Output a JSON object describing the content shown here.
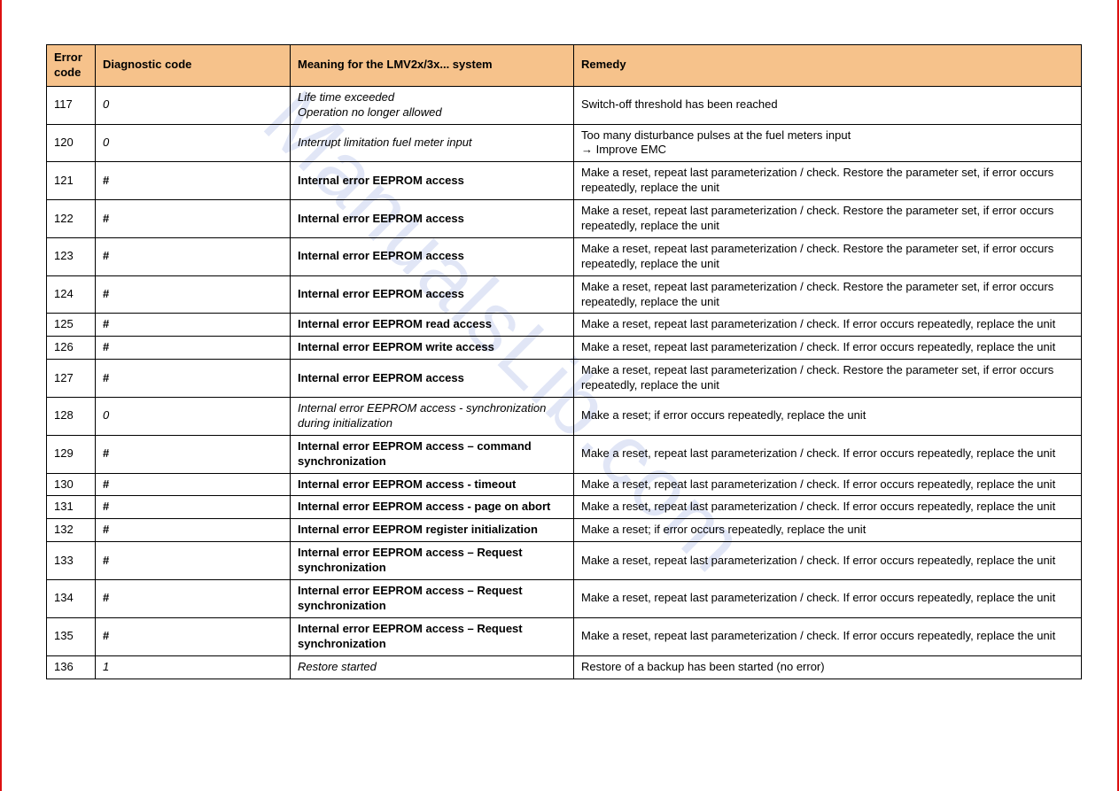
{
  "watermark": "ManualsLib.com",
  "headers": {
    "col1": "Error code",
    "col2": "Diagnostic code",
    "col3": "Meaning for the LMV2x/3x... system",
    "col4": "Remedy"
  },
  "rows": [
    {
      "code": "117",
      "diag": "0",
      "diag_style": "ital",
      "meaning": "Life time exceeded\nOperation no longer allowed",
      "meaning_style": "ital",
      "remedy": "Switch-off threshold has been reached"
    },
    {
      "code": "120",
      "diag": "0",
      "diag_style": "ital",
      "meaning": "Interrupt limitation fuel meter input",
      "meaning_style": "ital",
      "remedy": "Too many disturbance pulses at the fuel meters input\n→ Improve EMC"
    },
    {
      "code": "121",
      "diag": "#",
      "diag_style": "bold",
      "meaning": "Internal error EEPROM access",
      "meaning_style": "bold",
      "remedy": "Make a reset, repeat last parameterization / check. Restore the parameter set, if error occurs repeatedly, replace the unit"
    },
    {
      "code": "122",
      "diag": "#",
      "diag_style": "bold",
      "meaning": "Internal error EEPROM access",
      "meaning_style": "bold",
      "remedy": "Make a reset, repeat last parameterization / check. Restore the parameter set, if error occurs repeatedly, replace the unit"
    },
    {
      "code": "123",
      "diag": "#",
      "diag_style": "bold",
      "meaning": "Internal error EEPROM access",
      "meaning_style": "bold",
      "remedy": "Make a reset, repeat last parameterization / check. Restore the parameter set, if error occurs repeatedly, replace the unit"
    },
    {
      "code": "124",
      "diag": "#",
      "diag_style": "bold",
      "meaning": "Internal error EEPROM access",
      "meaning_style": "bold",
      "remedy": "Make a reset, repeat last parameterization / check. Restore the parameter set, if error occurs repeatedly, replace the unit"
    },
    {
      "code": "125",
      "diag": "#",
      "diag_style": "bold",
      "meaning": "Internal error EEPROM read access",
      "meaning_style": "bold",
      "remedy": "Make a reset, repeat last parameterization / check. If error occurs repeatedly, replace the unit"
    },
    {
      "code": "126",
      "diag": "#",
      "diag_style": "bold",
      "meaning": "Internal error EEPROM write access",
      "meaning_style": "bold",
      "remedy": "Make a reset, repeat last parameterization / check. If error occurs repeatedly, replace the unit"
    },
    {
      "code": "127",
      "diag": "#",
      "diag_style": "bold",
      "meaning": "Internal error EEPROM access",
      "meaning_style": "bold",
      "remedy": "Make a reset, repeat last parameterization / check. Restore the parameter set, if error occurs repeatedly, replace the unit"
    },
    {
      "code": "128",
      "diag": "0",
      "diag_style": "ital",
      "meaning": "Internal error EEPROM access - synchronization during initialization",
      "meaning_style": "ital",
      "remedy": "Make a reset; if error occurs repeatedly, replace the unit"
    },
    {
      "code": "129",
      "diag": "#",
      "diag_style": "bold",
      "meaning": "Internal error EEPROM access – command synchronization",
      "meaning_style": "bold",
      "remedy": "Make a reset, repeat last parameterization / check. If error occurs repeatedly, replace the unit"
    },
    {
      "code": "130",
      "diag": "#",
      "diag_style": "bold",
      "meaning": "Internal error EEPROM access - timeout",
      "meaning_style": "bold",
      "remedy": "Make a reset, repeat last parameterization / check. If error occurs repeatedly, replace the unit"
    },
    {
      "code": "131",
      "diag": "#",
      "diag_style": "bold",
      "meaning": "Internal error EEPROM access - page on abort",
      "meaning_style": "bold",
      "remedy": "Make a reset, repeat last parameterization / check. If error occurs repeatedly, replace the unit"
    },
    {
      "code": "132",
      "diag": "#",
      "diag_style": "bold",
      "meaning": "Internal error EEPROM register initialization",
      "meaning_style": "bold",
      "remedy": "Make a reset; if error occurs repeatedly, replace the unit"
    },
    {
      "code": "133",
      "diag": "#",
      "diag_style": "bold",
      "meaning": "Internal error EEPROM access – Request synchronization",
      "meaning_style": "bold",
      "remedy": "Make a reset, repeat last parameterization / check. If error occurs repeatedly, replace the unit"
    },
    {
      "code": "134",
      "diag": "#",
      "diag_style": "bold",
      "meaning": "Internal error EEPROM access – Request synchronization",
      "meaning_style": "bold",
      "remedy": "Make a reset, repeat last parameterization / check. If error occurs repeatedly, replace the unit"
    },
    {
      "code": "135",
      "diag": "#",
      "diag_style": "bold",
      "meaning": "Internal error EEPROM access – Request synchronization",
      "meaning_style": "bold",
      "remedy": "Make a reset, repeat last parameterization / check. If error occurs repeatedly, replace the unit"
    },
    {
      "code": "136",
      "diag": "1",
      "diag_style": "ital",
      "meaning": "Restore started",
      "meaning_style": "ital",
      "remedy": "Restore of a backup has been started (no error)"
    }
  ]
}
